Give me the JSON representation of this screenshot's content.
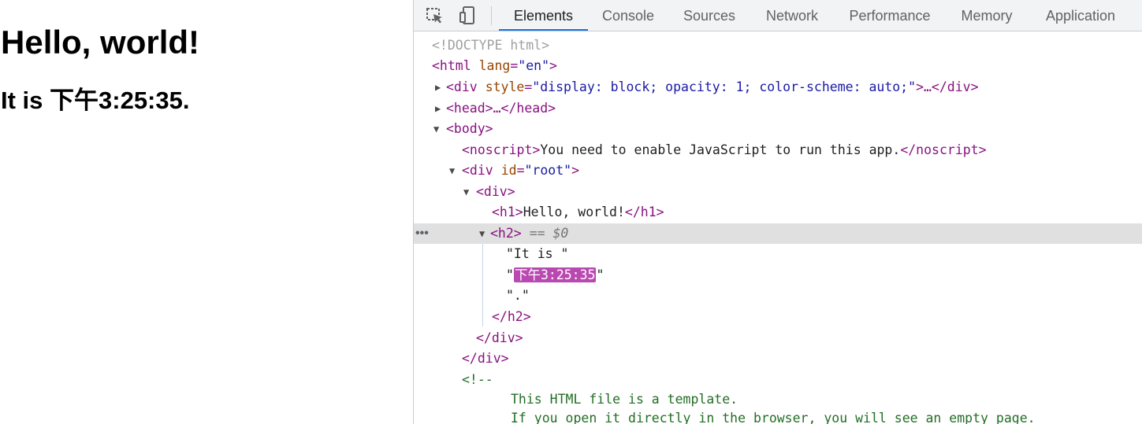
{
  "page": {
    "heading": "Hello, world!",
    "subheading": "It is 下午3:25:35."
  },
  "devtools": {
    "icons": [
      "inspect-element-icon",
      "device-toolbar-icon"
    ],
    "tabs": [
      {
        "label": "Elements",
        "active": true
      },
      {
        "label": "Console"
      },
      {
        "label": "Sources"
      },
      {
        "label": "Network"
      },
      {
        "label": "Performance"
      },
      {
        "label": "Memory"
      },
      {
        "label": "Application"
      }
    ],
    "tree": {
      "doctype": "<!DOCTYPE html>",
      "html_open": "<html",
      "html_attr": "lang",
      "html_attr_val": "\"en\"",
      "div_open": "<div",
      "div_attr": "style",
      "div_attr_val": "\"display: block; opacity: 1; color-scheme: auto;\"",
      "div_tail": ">…</div>",
      "head": "<head>…</head>",
      "body_open": "<body>",
      "noscript_open": "<noscript>",
      "noscript_text": "You need to enable JavaScript to run this app.",
      "noscript_close": "</noscript>",
      "root_open": "<div",
      "root_attr": "id",
      "root_attr_val": "\"root\"",
      "inner_div_open": "<div>",
      "h1_open": "<h1>",
      "h1_text": "Hello, world!",
      "h1_close": "</h1>",
      "h2_open": "<h2>",
      "h2_marker": "== $0",
      "text1": "\"It is \"",
      "text2_quote_open": "\"",
      "text2_value": "下午3:25:35",
      "text2_quote_close": "\"",
      "text3": "\".\"",
      "h2_close": "</h2>",
      "inner_div_close": "</div>",
      "root_close": "</div>",
      "comment_open": "<!--",
      "comment_line1": "This HTML file is a template.",
      "comment_line2": "If you open it directly in the browser, you will see an empty page.",
      "selected_row_menu": "•••"
    }
  },
  "colors": {
    "tag": "#881280",
    "attribute": "#994500",
    "attribute_value": "#1a1aa6",
    "comment": "#236e25",
    "active_tab_underline": "#1a73e8",
    "search_highlight": "#b949b0",
    "selected_row": "#e0e0e0"
  }
}
